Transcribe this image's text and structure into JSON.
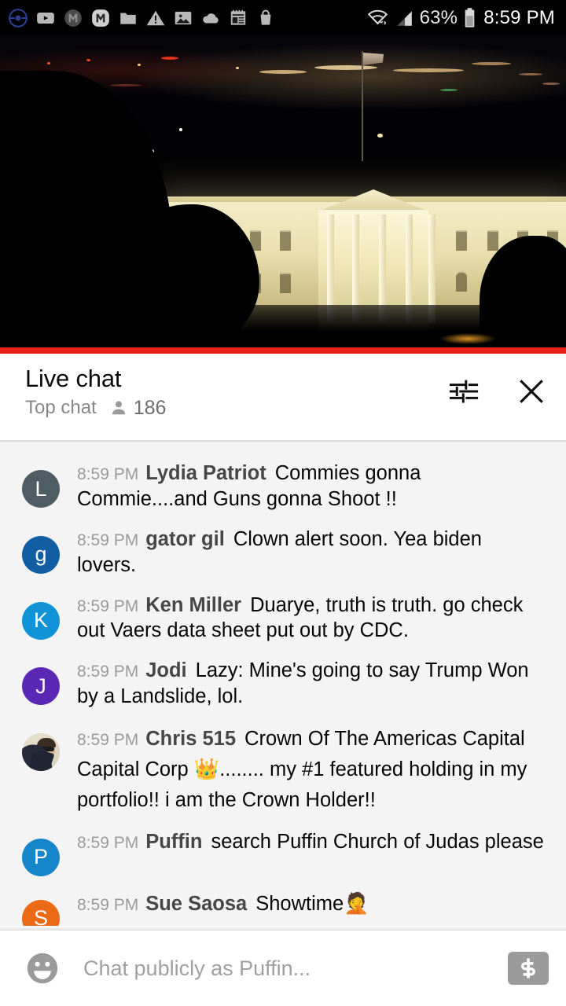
{
  "status_bar": {
    "icons": [
      "pokeball-icon",
      "youtube-icon",
      "m-app-dark-icon",
      "m-app-light-icon",
      "folder-icon",
      "warning-triangle-icon",
      "photo-icon",
      "cloud-icon",
      "notepad-icon",
      "shopping-bag-icon"
    ],
    "wifi_icon": "wifi-icon",
    "signal_icon": "cellular-signal-icon",
    "battery_percent": "63%",
    "battery_icon": "battery-icon",
    "time": "8:59 PM"
  },
  "video": {
    "description": "White House at night live stream",
    "progress_color": "#e8201a",
    "progress_percent": 100
  },
  "chat_header": {
    "title": "Live chat",
    "mode": "Top chat",
    "viewer_icon": "person-icon",
    "viewer_count": "186",
    "settings_icon": "tune-sliders-icon",
    "close_icon": "close-x-icon"
  },
  "messages": [
    {
      "timestamp": "8:59 PM",
      "author": "Lydia Patriot",
      "text": "Commies gonna Commie....and Guns gonna Shoot !!",
      "avatar_letter": "L",
      "avatar_color": "#4e5c63",
      "avatar_type": "letter"
    },
    {
      "timestamp": "8:59 PM",
      "author": "gator gil",
      "text": "Clown alert soon. Yea biden lovers.",
      "avatar_letter": "g",
      "avatar_color": "#115ea3",
      "avatar_type": "letter"
    },
    {
      "timestamp": "8:59 PM",
      "author": "Ken Miller",
      "text": "Duarye, truth is truth. go check out Vaers data sheet put out by CDC.",
      "avatar_letter": "K",
      "avatar_color": "#0f93d6",
      "avatar_type": "letter"
    },
    {
      "timestamp": "8:59 PM",
      "author": "Jodi",
      "text": "Lazy: Mine's going to say Trump Won by a Landslide, lol.",
      "avatar_letter": "J",
      "avatar_color": "#5b28b5",
      "avatar_type": "letter"
    },
    {
      "timestamp": "8:59 PM",
      "author": "Chris 515",
      "text_before": "Crown Of The Americas Capital Capital Corp ",
      "emoji": "👑",
      "text_after": "........ my #1 featured holding in my portfolio!! i am the Crown Holder!!",
      "avatar_type": "photo",
      "avatar_alt": "profile-photo-person-with-sunglasses"
    },
    {
      "timestamp": "8:59 PM",
      "author": "Puffin",
      "text": "search Puffin Church of Judas please",
      "avatar_letter": "P",
      "avatar_color": "#1685c9",
      "avatar_type": "letter"
    },
    {
      "timestamp": "8:59 PM",
      "author": "Sue Saosa",
      "text_before": "Showtime",
      "emoji": "🤦",
      "text_after": "",
      "avatar_letter": "S",
      "avatar_color": "#ec6a16",
      "avatar_type": "letter"
    }
  ],
  "input_bar": {
    "emoji_icon": "emoji-smiley-icon",
    "placeholder": "Chat publicly as Puffin...",
    "value": "",
    "superchat_icon": "dollar-sign-icon"
  }
}
